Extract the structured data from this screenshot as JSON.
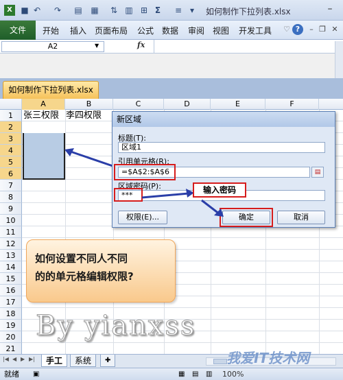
{
  "window": {
    "doc_title": "如何制作下拉列表.xlsx"
  },
  "ribbon": {
    "file_label": "文件",
    "tabs": [
      "开始",
      "插入",
      "页面布局",
      "公式",
      "数据",
      "审阅",
      "视图",
      "开发工具"
    ]
  },
  "formula_bar": {
    "name_box": "A2",
    "fx": "fx"
  },
  "workbook_tab": "如何制作下拉列表.xlsx",
  "grid": {
    "columns": [
      "A",
      "B",
      "C",
      "D",
      "E",
      "F"
    ],
    "rows": [
      "1",
      "2",
      "3",
      "4",
      "5",
      "6",
      "7",
      "8",
      "9",
      "10",
      "11",
      "12",
      "13",
      "14",
      "15",
      "16",
      "17",
      "18",
      "19",
      "20",
      "21"
    ],
    "a1": "张三权限",
    "b1": "李四权限"
  },
  "dialog": {
    "title": "新区域",
    "title_label": "标题(T):",
    "title_value": "区域1",
    "ref_label": "引用单元格(R):",
    "ref_value": "=$A$2:$A$6",
    "password_label": "区域密码(P):",
    "password_value": "***",
    "permissions_button": "权限(E)...",
    "ok_button": "确定",
    "cancel_button": "取消"
  },
  "callouts": {
    "password_hint": "输入密码",
    "note_line1": "如何设置不同人不同",
    "note_line2": "的的单元格编辑权限?",
    "byline": "By yianxss"
  },
  "sheet_tabs": [
    "手工",
    "系统"
  ],
  "status": {
    "ready": "就绪",
    "zoom": "100%"
  },
  "watermark": "我爱IT技术网",
  "colors": {
    "accent_red": "#d61c1c",
    "file_tab_green": "#2a6b30",
    "selection_blue": "#b8cce4"
  }
}
